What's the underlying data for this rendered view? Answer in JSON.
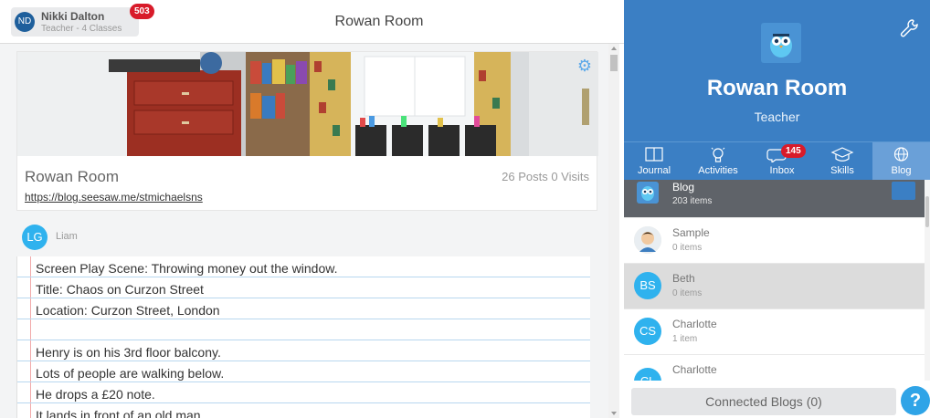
{
  "user": {
    "initials": "ND",
    "name": "Nikki Dalton",
    "role": "Teacher - 4 Classes",
    "notification_count": "503"
  },
  "page": {
    "title": "Rowan Room"
  },
  "blog_card": {
    "name": "Rowan Room",
    "stats": "26 Posts  0 Visits",
    "url": "https://blog.seesaw.me/stmichaelsns"
  },
  "post": {
    "author_initials": "LG",
    "author_name": "Liam",
    "lines": [
      "Screen Play Scene: Throwing money out the window.",
      "Title: Chaos on Curzon Street",
      "Location: Curzon Street, London",
      "",
      "Henry is on his 3rd floor balcony.",
      "Lots of people are walking below.",
      "He drops a £20 note.",
      "It lands in front of an old man."
    ]
  },
  "class": {
    "name": "Rowan Room",
    "role": "Teacher"
  },
  "nav": {
    "journal": "Journal",
    "activities": "Activities",
    "inbox": "Inbox",
    "inbox_count": "145",
    "skills": "Skills",
    "blog": "Blog"
  },
  "students": [
    {
      "name": "Blog",
      "count": "203 items",
      "initials": ""
    },
    {
      "name": "Sample",
      "count": "0 items",
      "initials": ""
    },
    {
      "name": "Beth",
      "count": "0 items",
      "initials": "BS"
    },
    {
      "name": "Charlotte",
      "count": "1 item",
      "initials": "CS"
    },
    {
      "name": "Charlotte",
      "count": "",
      "initials": "CL"
    }
  ],
  "footer": {
    "connected_blogs": "Connected Blogs (0)",
    "help": "?"
  },
  "colors": {
    "brand_blue": "#3b7fc4",
    "badge_red": "#d81b2a",
    "avatar_cyan": "#2fb2ee"
  }
}
